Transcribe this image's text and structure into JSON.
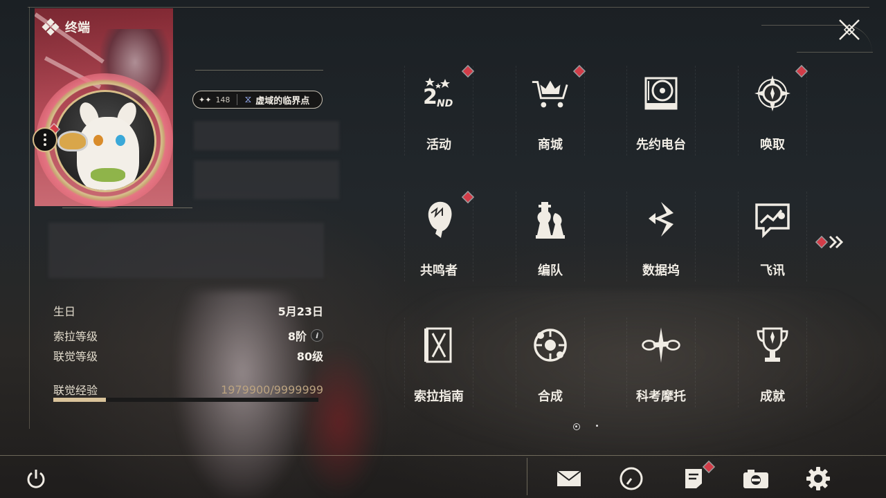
{
  "header": {
    "title": "终端"
  },
  "profile": {
    "title_badge": {
      "number": "148",
      "name": "虚域的临界点"
    },
    "info": [
      {
        "label": "生日",
        "value": "5月23日"
      },
      {
        "label": "索拉等级",
        "value": "8阶"
      },
      {
        "label": "联觉等级",
        "value": "80级"
      }
    ],
    "exp": {
      "label": "联觉经验",
      "value": "1979900/9999999",
      "progress": 0.198
    }
  },
  "menu": {
    "items": [
      {
        "label": "活动",
        "icon": "event-2nd-anniversary-icon",
        "badge": true
      },
      {
        "label": "商城",
        "icon": "shop-crown-cart-icon",
        "badge": true
      },
      {
        "label": "先约电台",
        "icon": "radio-vinyl-icon",
        "badge": false
      },
      {
        "label": "唤取",
        "icon": "convene-compass-icon",
        "badge": true
      },
      {
        "label": "共鸣者",
        "icon": "resonator-portrait-icon",
        "badge": true
      },
      {
        "label": "编队",
        "icon": "team-chess-icon",
        "badge": false
      },
      {
        "label": "数据坞",
        "icon": "data-bank-icon",
        "badge": false
      },
      {
        "label": "飞讯",
        "icon": "chat-message-icon",
        "badge": false
      },
      {
        "label": "索拉指南",
        "icon": "guidebook-icon",
        "badge": false
      },
      {
        "label": "合成",
        "icon": "synthesis-icon",
        "badge": false
      },
      {
        "label": "科考摩托",
        "icon": "motorcycle-icon",
        "badge": false
      },
      {
        "label": "成就",
        "icon": "trophy-icon",
        "badge": false
      }
    ],
    "page": {
      "current": 1,
      "total": 2
    }
  },
  "bottom_bar": {
    "items": [
      {
        "icon": "power-icon"
      },
      {
        "icon": "mail-icon"
      },
      {
        "icon": "clock-icon"
      },
      {
        "icon": "notice-icon",
        "badge": true
      },
      {
        "icon": "camera-icon"
      },
      {
        "icon": "settings-gear-icon"
      }
    ]
  },
  "colors": {
    "accent": "#d9c39a",
    "badge": "#d23c48",
    "card": "#b44c58"
  }
}
